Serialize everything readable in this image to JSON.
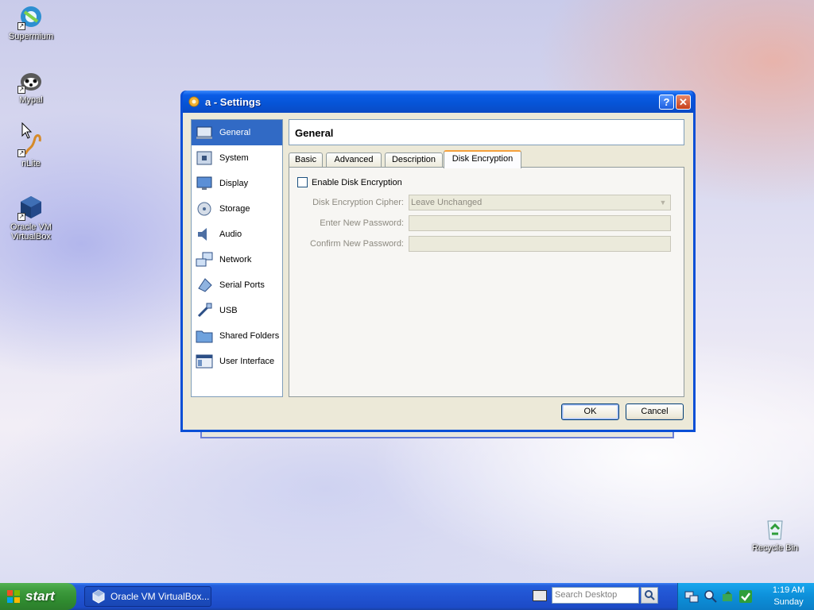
{
  "desktop": {
    "icons": [
      {
        "label": "Supermium",
        "icon": "supermium-icon"
      },
      {
        "label": "Mypal",
        "icon": "mypal-icon"
      },
      {
        "label": "nLite",
        "icon": "nlite-icon"
      },
      {
        "label": "Oracle VM VirtualBox",
        "icon": "virtualbox-icon"
      },
      {
        "label": "Recycle Bin",
        "icon": "recycle-bin-icon"
      }
    ]
  },
  "dialog": {
    "title": "a - Settings",
    "help_button": "?",
    "close_button": "✕",
    "sidebar": {
      "items": [
        {
          "label": "General",
          "icon": "general-icon",
          "selected": true
        },
        {
          "label": "System",
          "icon": "system-icon"
        },
        {
          "label": "Display",
          "icon": "display-icon"
        },
        {
          "label": "Storage",
          "icon": "storage-icon"
        },
        {
          "label": "Audio",
          "icon": "audio-icon"
        },
        {
          "label": "Network",
          "icon": "network-icon"
        },
        {
          "label": "Serial Ports",
          "icon": "serial-ports-icon"
        },
        {
          "label": "USB",
          "icon": "usb-icon"
        },
        {
          "label": "Shared Folders",
          "icon": "shared-folders-icon"
        },
        {
          "label": "User Interface",
          "icon": "user-interface-icon"
        }
      ]
    },
    "section_title": "General",
    "tabs": [
      {
        "label": "Basic"
      },
      {
        "label": "Advanced"
      },
      {
        "label": "Description"
      },
      {
        "label": "Disk Encryption",
        "active": true
      }
    ],
    "encryption": {
      "enable_label": "Enable Disk Encryption",
      "enabled": false,
      "cipher_label": "Disk Encryption Cipher:",
      "cipher_value": "Leave Unchanged",
      "new_password_label": "Enter New Password:",
      "new_password_value": "",
      "confirm_password_label": "Confirm New Password:",
      "confirm_password_value": ""
    },
    "ok_label": "OK",
    "cancel_label": "Cancel"
  },
  "taskbar": {
    "start_label": "start",
    "task_item": "Oracle VM VirtualBox...",
    "search_placeholder": "Search Desktop",
    "clock_time": "1:19 AM",
    "clock_day": "Sunday"
  },
  "colors": {
    "selection": "#316ac5",
    "title_blue": "#0a4fd6",
    "active_tab_accent": "#f5a03c"
  }
}
